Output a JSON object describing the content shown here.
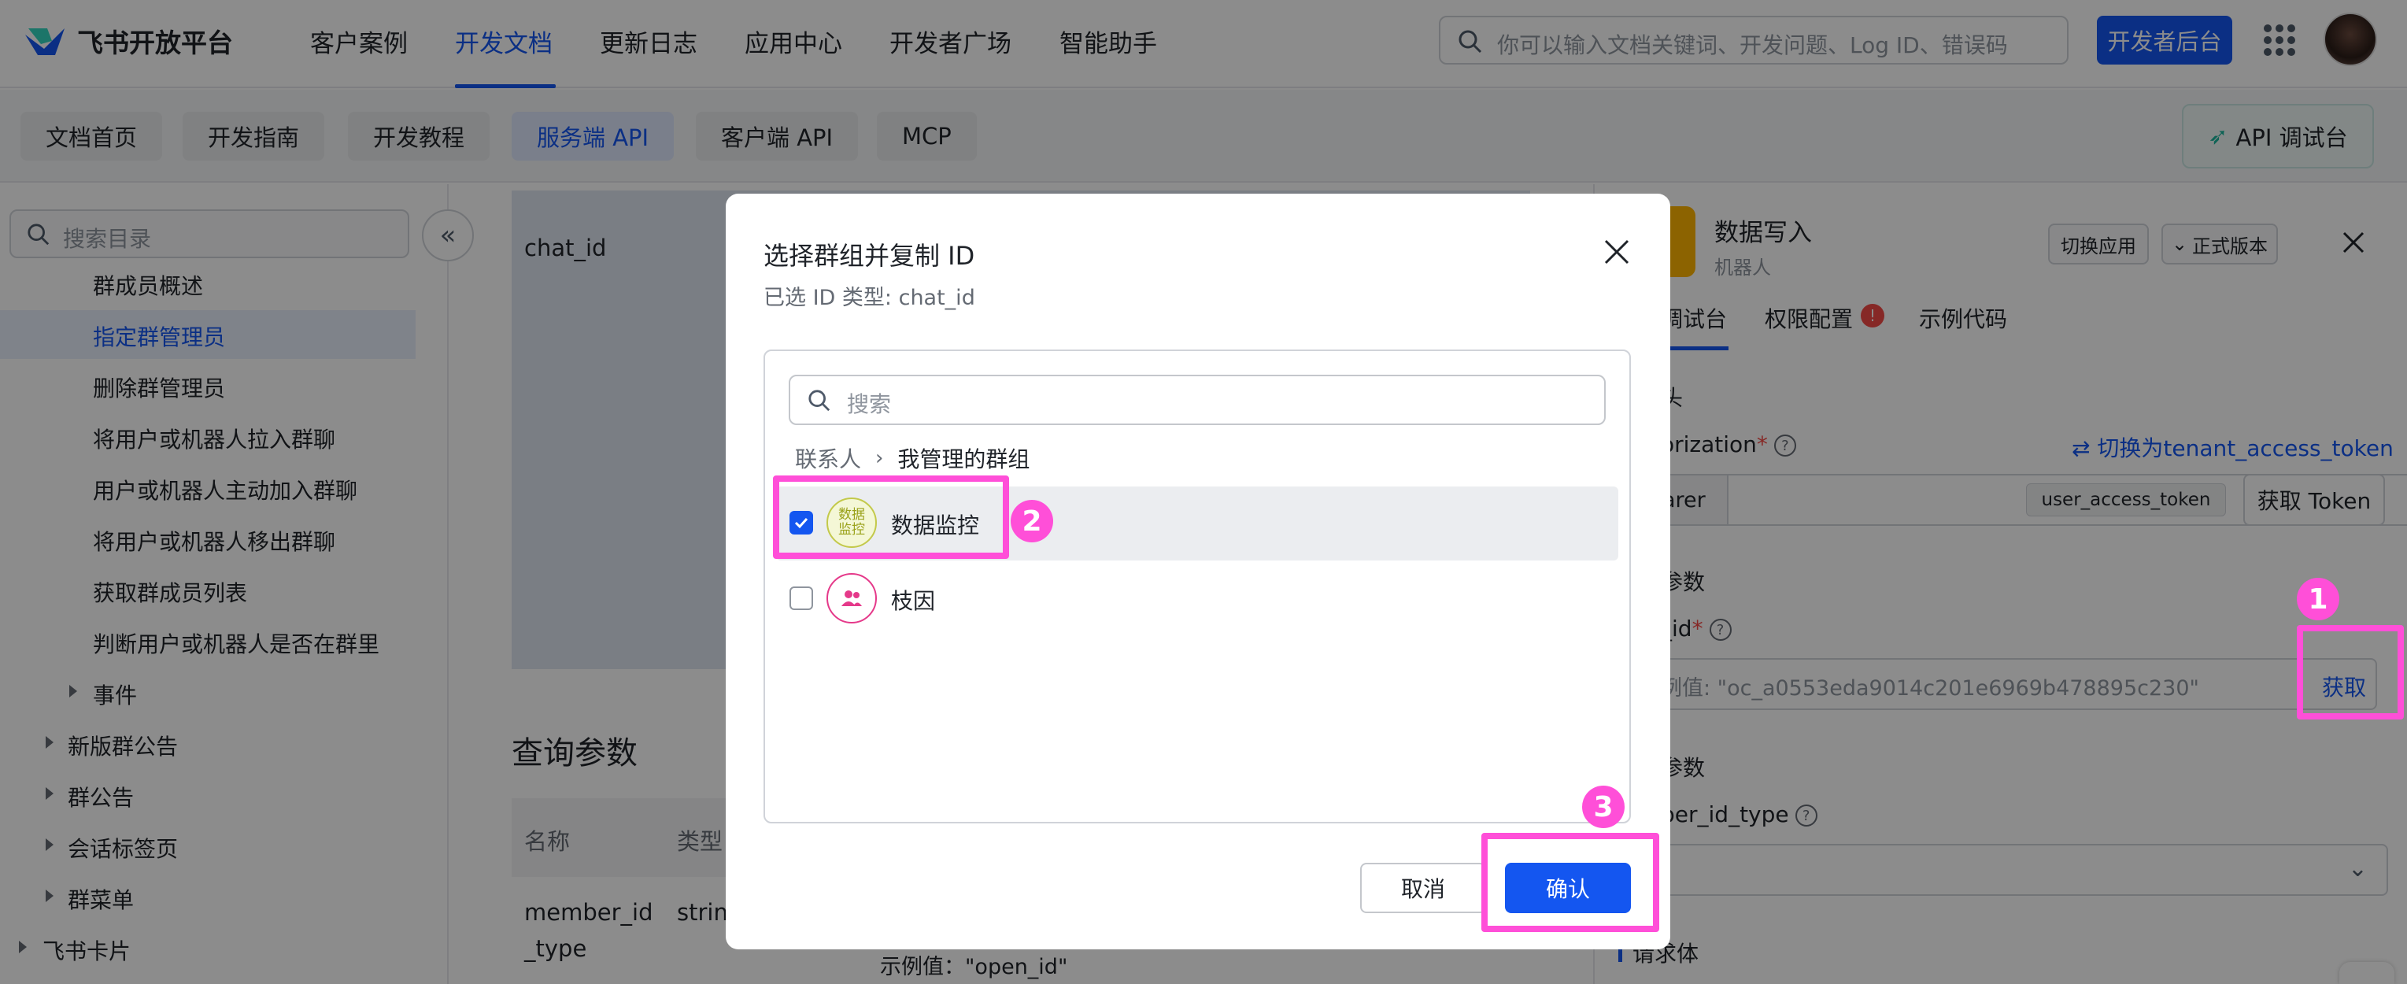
{
  "header": {
    "logo_text": "飞书开放平台",
    "nav": [
      "客户案例",
      "开发文档",
      "更新日志",
      "应用中心",
      "开发者广场",
      "智能助手"
    ],
    "active_nav": "开发文档",
    "search_placeholder": "你可以输入文档关键词、开发问题、Log ID、错误码",
    "dev_console_label": "开发者后台"
  },
  "subnav": {
    "tabs": [
      "文档首页",
      "开发指南",
      "开发教程",
      "服务端 API",
      "客户端 API",
      "MCP"
    ],
    "active_tab": "服务端 API",
    "api_console_label": "API 调试台"
  },
  "sidebar": {
    "search_placeholder": "搜索目录",
    "items": [
      {
        "label": "群成员概述",
        "level": 2
      },
      {
        "label": "指定群管理员",
        "level": 2,
        "active": true
      },
      {
        "label": "删除群管理员",
        "level": 2
      },
      {
        "label": "将用户或机器人拉入群聊",
        "level": 2
      },
      {
        "label": "用户或机器人主动加入群聊",
        "level": 2
      },
      {
        "label": "将用户或机器人移出群聊",
        "level": 2
      },
      {
        "label": "获取群成员列表",
        "level": 2
      },
      {
        "label": "判断用户或机器人是否在群里",
        "level": 2
      },
      {
        "label": "事件",
        "level": 2,
        "collapsible": true
      },
      {
        "label": "新版群公告",
        "level": 1,
        "collapsible": true
      },
      {
        "label": "群公告",
        "level": 1,
        "collapsible": true
      },
      {
        "label": "会话标签页",
        "level": 1,
        "collapsible": true
      },
      {
        "label": "群菜单",
        "level": 1,
        "collapsible": true
      },
      {
        "label": "飞书卡片",
        "level": 0,
        "collapsible": true
      }
    ]
  },
  "main": {
    "param_name": "chat_id",
    "query_section_title": "查询参数",
    "table_headers": [
      "名称",
      "类型"
    ],
    "row_name_line1": "member_id",
    "row_name_line2": "_type",
    "row_type": "strin",
    "example_text": "示例值：\"open_id\""
  },
  "right_panel": {
    "app_name": "数据写入",
    "app_type": "机器人",
    "switch_app_label": "切换应用",
    "version_label": "正式版本",
    "tabs": [
      "调试台",
      "权限配置",
      "示例代码"
    ],
    "section_header": "头",
    "authorization_label": "orization",
    "switch_token_link": "⇄ 切换为tenant_access_token",
    "bearer_label": "arer",
    "token_chip": "user_access_token",
    "get_token_label": "获取 Token",
    "path_params_label": "参数",
    "chat_id_label": "_id",
    "chat_id_placeholder": "例值: \"oc_a0553eda9014c201e6969b478895c230\"",
    "get_button": "获取",
    "query_params_label": "参数",
    "member_id_type_label": "ber_id_type",
    "request_body_label": "请求体"
  },
  "modal": {
    "title": "选择群组并复制 ID",
    "subtitle": "已选 ID 类型: chat_id",
    "search_placeholder": "搜索",
    "breadcrumb_root": "联系人",
    "breadcrumb_current": "我管理的群组",
    "groups": [
      {
        "name": "数据监控",
        "checked": true,
        "avatar_text_line1": "数据",
        "avatar_text_line2": "监控"
      },
      {
        "name": "枝因",
        "checked": false
      }
    ],
    "cancel_label": "取消",
    "confirm_label": "确认"
  },
  "annotations": {
    "badges": [
      "1",
      "2",
      "3"
    ],
    "highlight_color": "#ff4fd8"
  },
  "colors": {
    "accent": "#1456f0",
    "highlight": "#ff4fd8"
  }
}
